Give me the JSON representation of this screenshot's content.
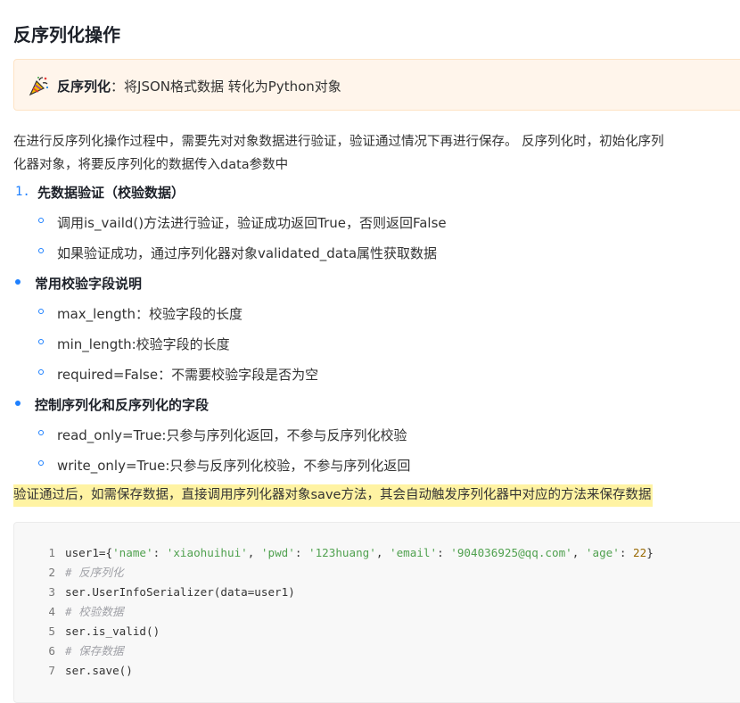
{
  "heading": "反序列化操作",
  "note": {
    "label": "反序列化",
    "sep": "：",
    "text": "将JSON格式数据 转化为Python对象"
  },
  "intro": {
    "line1": "在进行反序列化操作过程中，需要先对对象数据进行验证，验证通过情况下再进行保存。 反序列化时，初始化序列",
    "line2": "化器对象，将要反序列化的数据传入data参数中"
  },
  "list": [
    {
      "marker": "1.",
      "title": "先数据验证（校验数据）",
      "items": [
        "调用is_vaild()方法进行验证，验证成功返回True，否则返回False",
        "如果验证成功，通过序列化器对象validated_data属性获取数据"
      ]
    },
    {
      "marker": "•",
      "title": "常用校验字段说明",
      "items": [
        "max_length：校验字段的长度",
        "min_length:校验字段的长度",
        "required=False：不需要校验字段是否为空"
      ]
    },
    {
      "marker": "•",
      "title": "控制序列化和反序列化的字段",
      "items": [
        "read_only=True:只参与序列化返回，不参与反序列化校验",
        "write_only=True:只参与反序列化校验，不参与序列化返回"
      ]
    }
  ],
  "highlight": "验证通过后，如需保存数据，直接调用序列化器对象save方法，其会自动触发序列化器中对应的方法来保存数据",
  "code": [
    {
      "n": "1",
      "tokens": [
        {
          "t": "plain",
          "v": "user1={"
        },
        {
          "t": "str",
          "v": "'name'"
        },
        {
          "t": "plain",
          "v": ": "
        },
        {
          "t": "str",
          "v": "'xiaohuihui'"
        },
        {
          "t": "plain",
          "v": ", "
        },
        {
          "t": "str",
          "v": "'pwd'"
        },
        {
          "t": "plain",
          "v": ": "
        },
        {
          "t": "str",
          "v": "'123huang'"
        },
        {
          "t": "plain",
          "v": ", "
        },
        {
          "t": "str",
          "v": "'email'"
        },
        {
          "t": "plain",
          "v": ": "
        },
        {
          "t": "str",
          "v": "'904036925@qq.com'"
        },
        {
          "t": "plain",
          "v": ", "
        },
        {
          "t": "str",
          "v": "'age'"
        },
        {
          "t": "plain",
          "v": ": "
        },
        {
          "t": "num",
          "v": "22"
        },
        {
          "t": "plain",
          "v": "}"
        }
      ]
    },
    {
      "n": "2",
      "tokens": [
        {
          "t": "comment",
          "v": "# 反序列化"
        }
      ]
    },
    {
      "n": "3",
      "tokens": [
        {
          "t": "plain",
          "v": "ser.UserInfoSerializer(data=user1)"
        }
      ]
    },
    {
      "n": "4",
      "tokens": [
        {
          "t": "comment",
          "v": "# 校验数据"
        }
      ]
    },
    {
      "n": "5",
      "tokens": [
        {
          "t": "plain",
          "v": "ser.is_valid()"
        }
      ]
    },
    {
      "n": "6",
      "tokens": [
        {
          "t": "comment",
          "v": "# 保存数据"
        }
      ]
    },
    {
      "n": "7",
      "tokens": [
        {
          "t": "plain",
          "v": "ser.save()"
        }
      ]
    }
  ],
  "colors": {
    "accent": "#1e80ff",
    "note_bg": "#fff5eb",
    "highlight_bg": "#fff3a3",
    "code_bg": "#f8f8f8"
  },
  "icons": {
    "note": "party-popper-icon"
  }
}
